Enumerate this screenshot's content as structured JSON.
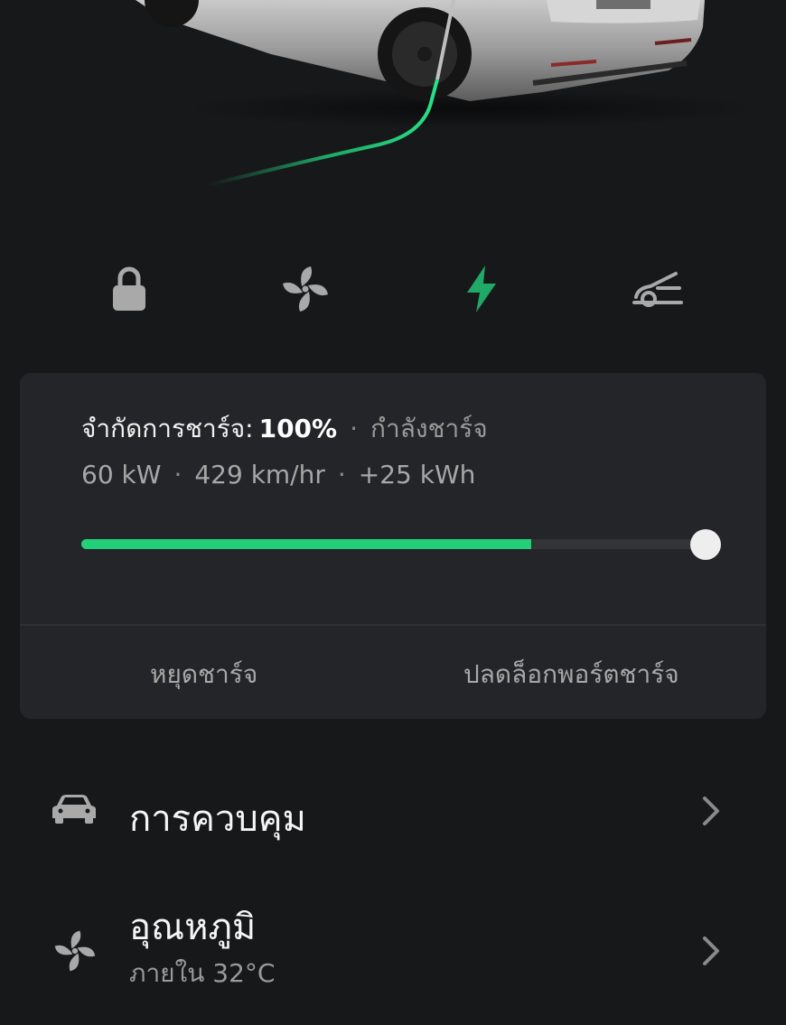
{
  "quick_controls": {
    "lock_icon": "lock-icon",
    "climate_icon": "fan-icon",
    "charge_icon": "lightning-bolt-icon",
    "frunk_icon": "car-frunk-icon"
  },
  "colors": {
    "background": "#17181a",
    "card": "#242528",
    "accent_green": "#22d07a",
    "bolt_green": "#1fa866"
  },
  "charging": {
    "limit_label": "จำกัดการชาร์จ:",
    "limit_value": "100%",
    "status": "กำลังชาร์จ",
    "power": "60 kW",
    "rate": "429 km/hr",
    "energy_added": "+25 kWh",
    "charge_level_percent": 72,
    "charge_limit_percent": 100,
    "stop_button": "หยุดชาร์จ",
    "unlock_port_button": "ปลดล็อกพอร์ตชาร์จ"
  },
  "menu": [
    {
      "title": "การควบคุม",
      "subtitle": "",
      "icon": "car-icon"
    },
    {
      "title": "อุณหภูมิ",
      "subtitle": "ภายใน 32°C",
      "icon": "fan-icon"
    }
  ]
}
